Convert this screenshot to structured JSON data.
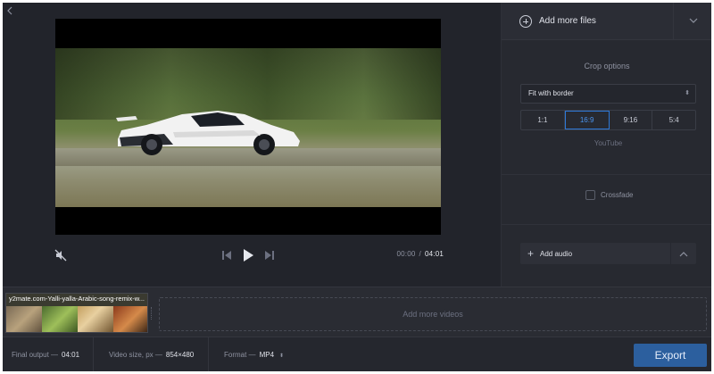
{
  "colors": {
    "accent": "#2e78d6",
    "export_bg": "#2c5f9e",
    "background": "#22242b"
  },
  "header": {
    "back_icon": "chevron-left-icon"
  },
  "player": {
    "current_time": "00:00",
    "separator": "/",
    "total_time": "04:01",
    "icons": [
      "mute-icon",
      "skip-back-icon",
      "play-icon",
      "skip-forward-icon"
    ]
  },
  "panel": {
    "add_files_label": "Add more files",
    "crop_title": "Crop options",
    "crop_mode": "Fit with border",
    "ratios": [
      "1:1",
      "16:9",
      "9:16",
      "5:4"
    ],
    "active_ratio": "16:9",
    "ratio_hint": "YouTube",
    "crossfade_label": "Crossfade",
    "crossfade_checked": false,
    "add_audio_label": "Add audio"
  },
  "timeline": {
    "clip_name": "y2mate.com-Yalli-yalla-Arabic-song-remix-w...",
    "add_videos_label": "Add more videos"
  },
  "bottombar": {
    "final_output_label": "Final output —",
    "final_output_value": "04:01",
    "video_size_label": "Video size, px —",
    "video_size_value": "854×480",
    "format_label": "Format —",
    "format_value": "MP4",
    "export_label": "Export"
  }
}
